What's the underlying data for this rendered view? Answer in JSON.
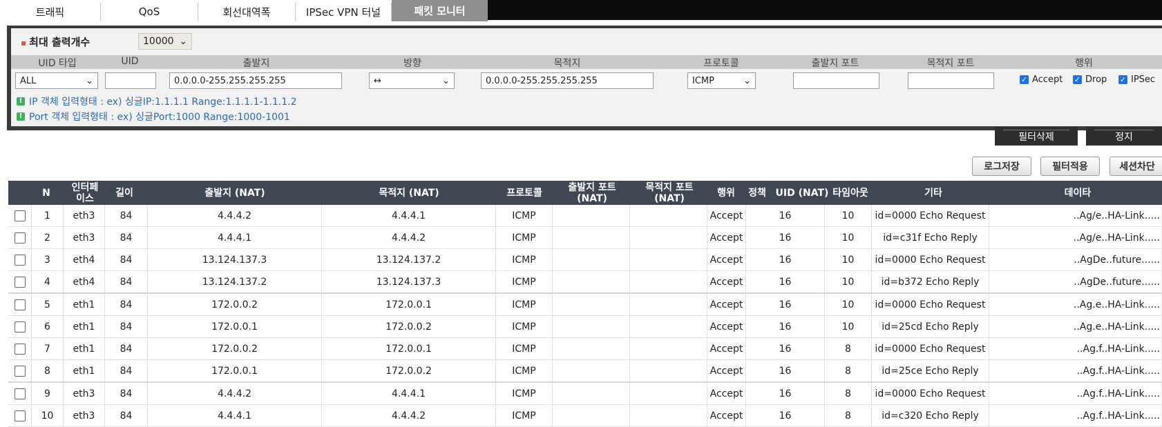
{
  "tabs": [
    {
      "label": "트래픽"
    },
    {
      "label": "QoS"
    },
    {
      "label": "회선대역폭"
    },
    {
      "label": "IPSec VPN 터널"
    },
    {
      "label": "패킷 모니터"
    }
  ],
  "filter": {
    "max_label": "최대 출력개수",
    "max_value": "10000",
    "headers": [
      "UID 타입",
      "UID",
      "출발지",
      "방향",
      "목적지",
      "프로토콜",
      "출발지 포트",
      "목적지 포트",
      "행위"
    ],
    "uid_type": "ALL",
    "uid": "",
    "src": "0.0.0.0-255.255.255.255",
    "direction": "↔",
    "dst": "0.0.0.0-255.255.255.255",
    "protocol": "ICMP",
    "src_port": "",
    "dst_port": "",
    "actions": {
      "accept": "Accept",
      "drop": "Drop",
      "ipsec": "IPSec"
    },
    "hint_ip": "IP 객체 입력형태 : ex) 싱글IP:1.1.1.1 Range:1.1.1.1-1.1.1.2",
    "hint_port": "Port 객체 입력형태 : ex) 싱글Port:1000 Range:1000-1001"
  },
  "buttons": {
    "filter_delete": "필터삭제",
    "stop": "정지",
    "log_save": "로그저장",
    "filter_apply": "필터적용",
    "session_block": "세션차단"
  },
  "table": {
    "headers": {
      "n": "N",
      "iface": "인터페이스",
      "len": "길이",
      "src": "출발지 (NAT)",
      "dst": "목적지 (NAT)",
      "proto": "프로토콜",
      "sport": "출발지 포트 (NAT)",
      "dport": "목적지 포트 (NAT)",
      "action": "행위",
      "policy": "정책",
      "uid": "UID (NAT)",
      "timeout": "타임아웃",
      "etc": "기타",
      "data": "데이타"
    },
    "rows": [
      {
        "n": "1",
        "iface": "eth3",
        "len": "84",
        "src": "4.4.4.2",
        "dst": "4.4.4.1",
        "proto": "ICMP",
        "sport": "",
        "dport": "",
        "action": "Accept",
        "uid": "16",
        "timeout": "10",
        "etc": "id=0000 Echo Request",
        "data": "..Ag/e..HA-Link....."
      },
      {
        "n": "2",
        "iface": "eth3",
        "len": "84",
        "src": "4.4.4.1",
        "dst": "4.4.4.2",
        "proto": "ICMP",
        "sport": "",
        "dport": "",
        "action": "Accept",
        "uid": "16",
        "timeout": "10",
        "etc": "id=c31f Echo Reply",
        "data": "..Ag/e..HA-Link....."
      },
      {
        "n": "3",
        "iface": "eth4",
        "len": "84",
        "src": "13.124.137.3",
        "dst": "13.124.137.2",
        "proto": "ICMP",
        "sport": "",
        "dport": "",
        "action": "Accept",
        "uid": "16",
        "timeout": "10",
        "etc": "id=0000 Echo Request",
        "data": "..AgDe..future......"
      },
      {
        "n": "4",
        "iface": "eth4",
        "len": "84",
        "src": "13.124.137.2",
        "dst": "13.124.137.3",
        "proto": "ICMP",
        "sport": "",
        "dport": "",
        "action": "Accept",
        "uid": "16",
        "timeout": "10",
        "etc": "id=b372 Echo Reply",
        "data": "..AgDe..future......"
      },
      {
        "n": "5",
        "iface": "eth1",
        "len": "84",
        "src": "172.0.0.2",
        "dst": "172.0.0.1",
        "proto": "ICMP",
        "sport": "",
        "dport": "",
        "action": "Accept",
        "uid": "16",
        "timeout": "10",
        "etc": "id=0000 Echo Request",
        "data": "..Ag.e..HA-Link....."
      },
      {
        "n": "6",
        "iface": "eth1",
        "len": "84",
        "src": "172.0.0.1",
        "dst": "172.0.0.2",
        "proto": "ICMP",
        "sport": "",
        "dport": "",
        "action": "Accept",
        "uid": "16",
        "timeout": "10",
        "etc": "id=25cd Echo Reply",
        "data": "..Ag.e..HA-Link....."
      },
      {
        "n": "7",
        "iface": "eth1",
        "len": "84",
        "src": "172.0.0.2",
        "dst": "172.0.0.1",
        "proto": "ICMP",
        "sport": "",
        "dport": "",
        "action": "Accept",
        "uid": "16",
        "timeout": "8",
        "etc": "id=0000 Echo Request",
        "data": "..Ag.f..HA-Link....."
      },
      {
        "n": "8",
        "iface": "eth1",
        "len": "84",
        "src": "172.0.0.1",
        "dst": "172.0.0.2",
        "proto": "ICMP",
        "sport": "",
        "dport": "",
        "action": "Accept",
        "uid": "16",
        "timeout": "8",
        "etc": "id=25ce Echo Reply",
        "data": "..Ag.f..HA-Link....."
      },
      {
        "n": "9",
        "iface": "eth3",
        "len": "84",
        "src": "4.4.4.2",
        "dst": "4.4.4.1",
        "proto": "ICMP",
        "sport": "",
        "dport": "",
        "action": "Accept",
        "uid": "16",
        "timeout": "8",
        "etc": "id=0000 Echo Request",
        "data": "..Ag.f..HA-Link....."
      },
      {
        "n": "10",
        "iface": "eth3",
        "len": "84",
        "src": "4.4.4.1",
        "dst": "4.4.4.2",
        "proto": "ICMP",
        "sport": "",
        "dport": "",
        "action": "Accept",
        "uid": "16",
        "timeout": "8",
        "etc": "id=c320 Echo Reply",
        "data": "..Ag.f..HA-Link....."
      }
    ]
  }
}
